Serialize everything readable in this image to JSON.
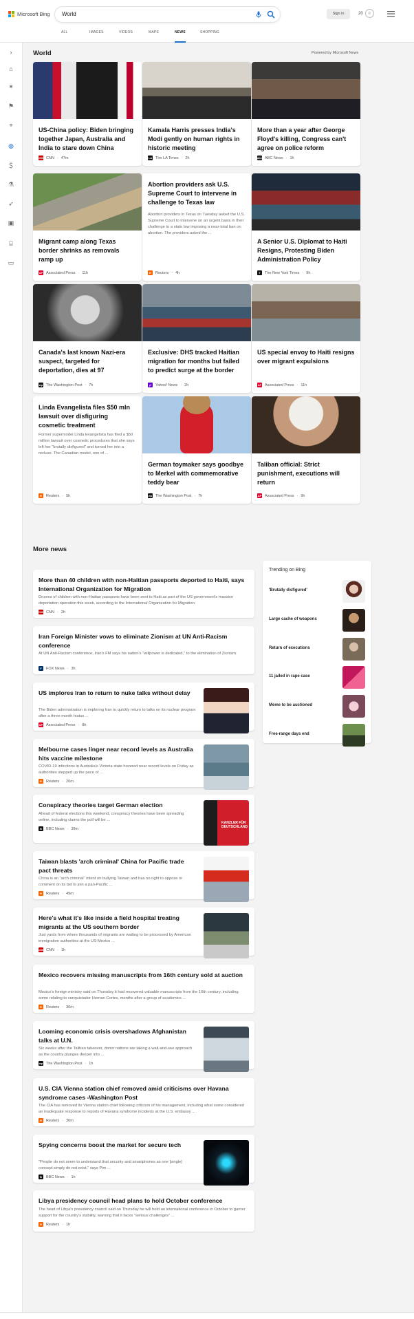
{
  "app": {
    "brand": "Microsoft Bing",
    "query": "World",
    "signin": "Sign in",
    "points": "20"
  },
  "nav": {
    "tabs": [
      "ALL",
      "IMAGES",
      "VIDEOS",
      "MAPS",
      "NEWS",
      "SHOPPING"
    ],
    "active": "NEWS"
  },
  "rail": {
    "icons": [
      "chevron-right-icon",
      "home-icon",
      "trophy-icon",
      "flag-icon",
      "location-icon",
      "globe-icon",
      "money-icon",
      "microscope-icon",
      "rocket-icon",
      "film-icon",
      "bank-icon",
      "card-icon"
    ]
  },
  "section": {
    "title": "World",
    "powered": "Powered by Microsoft News"
  },
  "top_stories": [
    {
      "title": "US-China policy: Biden bringing together Japan, Australia and India to stare down China",
      "source": "CNN",
      "time": "47m",
      "logo_color": "#cc0000",
      "logo": "CNN"
    },
    {
      "title": "Kamala Harris presses India's Modi gently on human rights in historic meeting",
      "source": "The LA Times",
      "time": "2h",
      "logo_color": "#111111",
      "logo": "LA"
    },
    {
      "title": "More than a year after George Floyd's killing, Congress can't agree on police reform",
      "source": "ABC News",
      "time": "1h",
      "logo_color": "#222222",
      "logo": "abc"
    },
    {
      "title": "Migrant camp along Texas border shrinks as removals ramp up",
      "source": "Associated Press",
      "time": "11h",
      "logo_color": "#e4002b",
      "logo": "AP"
    },
    {
      "title": "Abortion providers ask U.S. Supreme Court to intervene in challenge to Texas law",
      "snippet": "Abortion providers in Texas on Tuesday asked the U.S. Supreme Court to intervene on an urgent basis in their challenge to a state law imposing a near-total ban on abortion. The providers asked the ...",
      "source": "Reuters",
      "time": "4h",
      "logo_color": "#fa6400",
      "logo": "R"
    },
    {
      "title": "A Senior U.S. Diplomat to Haiti Resigns, Protesting Biden Administration Policy",
      "source": "The New York Times",
      "time": "9h",
      "logo_color": "#111111",
      "logo": "T"
    },
    {
      "title": "Canada's last known Nazi-era suspect, targeted for deportation, dies at 97",
      "source": "The Washington Post",
      "time": "7h",
      "logo_color": "#111111",
      "logo": "wp"
    },
    {
      "title": "Exclusive: DHS tracked Haitian migration for months but failed to predict surge at the border",
      "source": "Yahoo! News",
      "time": "2h",
      "logo_color": "#6001d2",
      "logo": "y!"
    },
    {
      "title": "US special envoy to Haiti resigns over migrant expulsions",
      "source": "Associated Press",
      "time": "11h",
      "logo_color": "#e4002b",
      "logo": "AP"
    },
    {
      "title": "Linda Evangelista files $50 mln lawsuit over disfiguring cosmetic treatment",
      "snippet": "Former supermodel Linda Evangelista has filed a $50 million lawsuit over cosmetic procedures that she says left her \"brutally disfigured\" and turned her into a recluse. The Canadian model, one of ...",
      "source": "Reuters",
      "time": "5h",
      "logo_color": "#fa6400",
      "logo": "R"
    },
    {
      "title": "German toymaker says goodbye to Merkel with commemorative teddy bear",
      "source": "The Washington Post",
      "time": "7h",
      "logo_color": "#111111",
      "logo": "wp"
    },
    {
      "title": "Taliban official: Strict punishment, executions will return",
      "source": "Associated Press",
      "time": "9h",
      "logo_color": "#e4002b",
      "logo": "AP"
    }
  ],
  "more": {
    "title": "More news",
    "items": [
      {
        "title": "More than 40 children with non-Haitian passports deported to Haiti, says International Organization for Migration",
        "desc": "Dozens of children with non-Haitian passports have been sent to Haiti as part of the US government's massive deportation operation this week, according to the International Organization for Migration.",
        "source": "CNN",
        "time": "2h",
        "logo_color": "#cc0000",
        "logo": "CNN"
      },
      {
        "title": "Iran Foreign Minister vows to eliminate Zionism at UN Anti-Racism conference",
        "desc": "At UN Anti-Racism conference, Iran's FM says his nation's \"willpower is dedicated,\" to the elimination of Zionism.",
        "source": "FOX News",
        "time": "3h",
        "logo_color": "#003366",
        "logo": "F"
      },
      {
        "title": "US implores Iran to return to nuke talks without delay",
        "desc": "The Biden administration is imploring Iran to quickly return to talks on its nuclear program after a three-month hiatus ...",
        "source": "Associated Press",
        "time": "8h",
        "logo_color": "#e4002b",
        "logo": "AP"
      },
      {
        "title": "Melbourne cases linger near record levels as Australia hits vaccine milestone",
        "desc": "COVID-19 infections in Australia's Victoria state hovered near record levels on Friday as authorities stepped up the pace of ...",
        "source": "Reuters",
        "time": "20m",
        "logo_color": "#fa6400",
        "logo": "R"
      },
      {
        "title": "Conspiracy theories target German election",
        "desc": "Ahead of federal elections this weekend, conspiracy theories have been spreading online, including claims the poll will be ...",
        "source": "BBC News",
        "time": "39m",
        "logo_color": "#111111",
        "logo": "B",
        "thumb_text": "KANZLER FÜR DEUTSCHLAND"
      },
      {
        "title": "Taiwan blasts 'arch criminal' China for Pacific trade pact threats",
        "desc": "China is an \"arch criminal\" intent on bullying Taiwan and has no right to oppose or comment on its bid to join a pan-Pacific ...",
        "source": "Reuters",
        "time": "49m",
        "logo_color": "#fa6400",
        "logo": "R"
      },
      {
        "title": "Here's what it's like inside a field hospital treating migrants at the US southern border",
        "desc": "Just yards from where thousands of migrants are waiting to be processed by American immigration authorities at the US-Mexico ...",
        "source": "CNN",
        "time": "1h",
        "logo_color": "#cc0000",
        "logo": "CNN"
      },
      {
        "title": "Mexico recovers missing manuscripts from 16th century sold at auction",
        "desc": "Mexico's foreign ministry said on Thursday it had recovered valuable manuscripts from the 16th century, including some relating to conquistador Hernan Cortes, months after a group of academics ...",
        "source": "Reuters",
        "time": "36m",
        "logo_color": "#fa6400",
        "logo": "R"
      },
      {
        "title": "Looming economic crisis overshadows Afghanistan talks at U.N.",
        "desc": "Six weeks after the Taliban takeover, donor nations are taking a wait-and-see approach as the country plunges deeper into ...",
        "source": "The Washington Post",
        "time": "1h",
        "logo_color": "#111111",
        "logo": "wp"
      },
      {
        "title": "U.S. CIA Vienna station chief removed amid criticisms over Havana syndrome cases -Washington Post",
        "desc": "The CIA has removed its Vienna station chief following criticism of his management, including what some considered an inadequate response to reports of Havana syndrome incidents at the U.S. embassy ...",
        "source": "Reuters",
        "time": "30m",
        "logo_color": "#fa6400",
        "logo": "R"
      },
      {
        "title": "Spying concerns boost the market for secure tech",
        "desc": "\"People do not seem to understand that security and smartphones as one [single] concept simply do not exist,\" says Pim ...",
        "source": "BBC News",
        "time": "1h",
        "logo_color": "#111111",
        "logo": "B"
      },
      {
        "title": "Libya presidency council head plans to hold October conference",
        "desc": "The head of Libya's presidency council said on Thursday he will hold an international conference in October to garner support for the country's stability, warning that it faces \"serious challenges\" ...",
        "source": "Reuters",
        "time": "1h",
        "logo_color": "#fa6400",
        "logo": "R"
      }
    ]
  },
  "trending": {
    "title": "Trending on Bing",
    "items": [
      "'Brutally disfigured'",
      "Large cache of weapons",
      "Return of executions",
      "11 jailed in rape case",
      "Meme to be auctioned",
      "Free-range days end"
    ]
  }
}
